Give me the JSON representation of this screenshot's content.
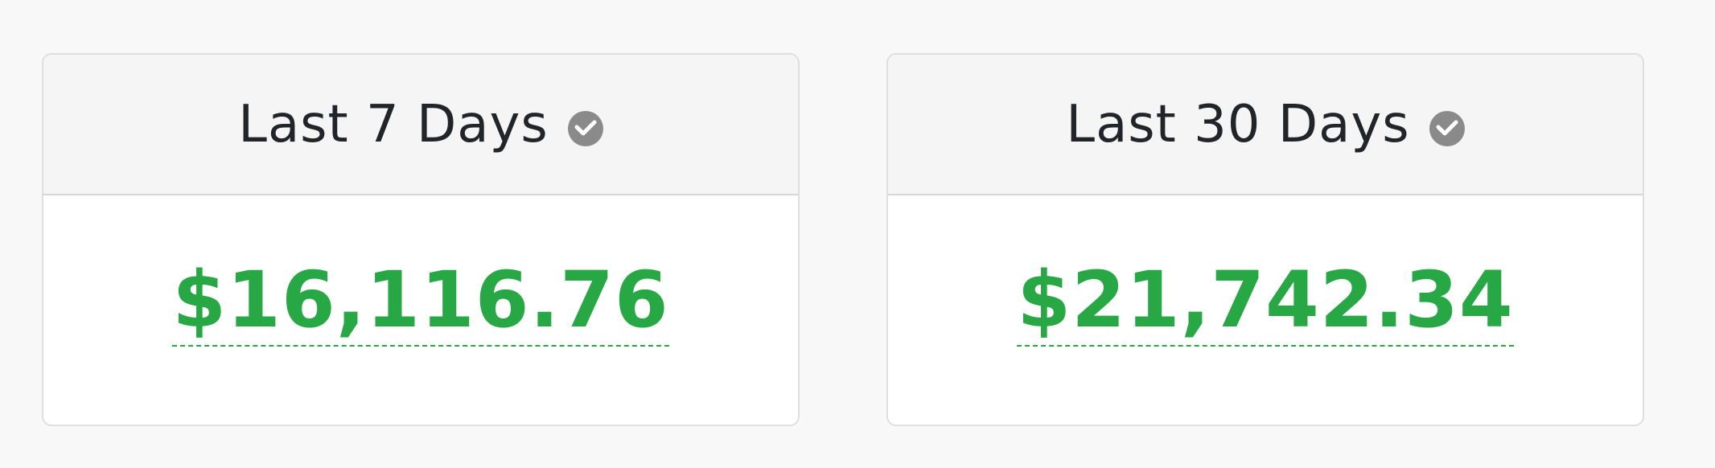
{
  "colors": {
    "amount": "#28a745",
    "title": "#212529",
    "icon_bg": "#8a8a8a",
    "header_bg": "#f5f5f5",
    "page_bg": "#f8f8f8"
  },
  "cards": [
    {
      "title": "Last 7 Days",
      "icon": "chevron-down-icon",
      "amount": "$16,116.76"
    },
    {
      "title": "Last 30 Days",
      "icon": "chevron-down-icon",
      "amount": "$21,742.34"
    }
  ]
}
